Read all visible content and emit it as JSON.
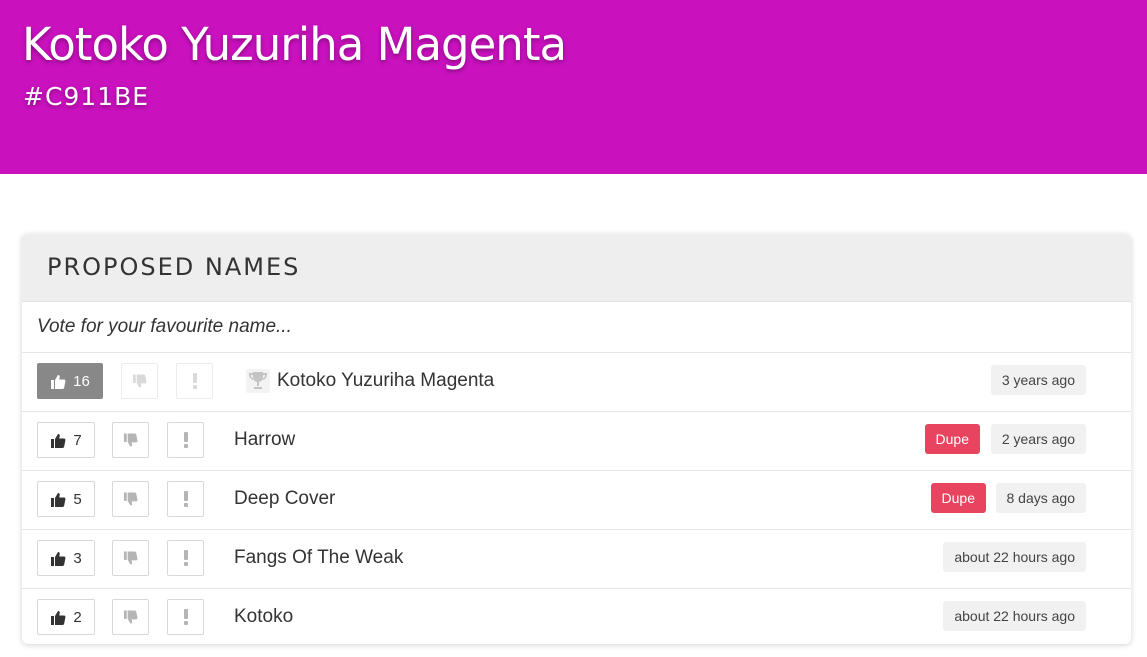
{
  "color": {
    "name": "Kotoko Yuzuriha Magenta",
    "hex": "#C911BE"
  },
  "panel": {
    "title": "PROPOSED NAMES",
    "prompt": "Vote for your favourite name..."
  },
  "names": [
    {
      "votes": "16",
      "name": "Kotoko Yuzuriha Magenta",
      "time": "3 years ago",
      "dupe": "",
      "winner": true
    },
    {
      "votes": "7",
      "name": "Harrow",
      "time": "2 years ago",
      "dupe": "Dupe",
      "winner": false
    },
    {
      "votes": "5",
      "name": "Deep Cover",
      "time": "8 days ago",
      "dupe": "Dupe",
      "winner": false
    },
    {
      "votes": "3",
      "name": "Fangs Of The Weak",
      "time": "about 22 hours ago",
      "dupe": "",
      "winner": false
    },
    {
      "votes": "2",
      "name": "Kotoko",
      "time": "about 22 hours ago",
      "dupe": "",
      "winner": false
    }
  ],
  "icons": {
    "upvote": "thumbs-up-icon",
    "downvote": "thumbs-down-icon",
    "flag": "exclamation-icon",
    "winner": "trophy-icon"
  },
  "colors": {
    "hero": "#C911BE",
    "dupe": "#E8435F",
    "active_vote": "#888888"
  }
}
